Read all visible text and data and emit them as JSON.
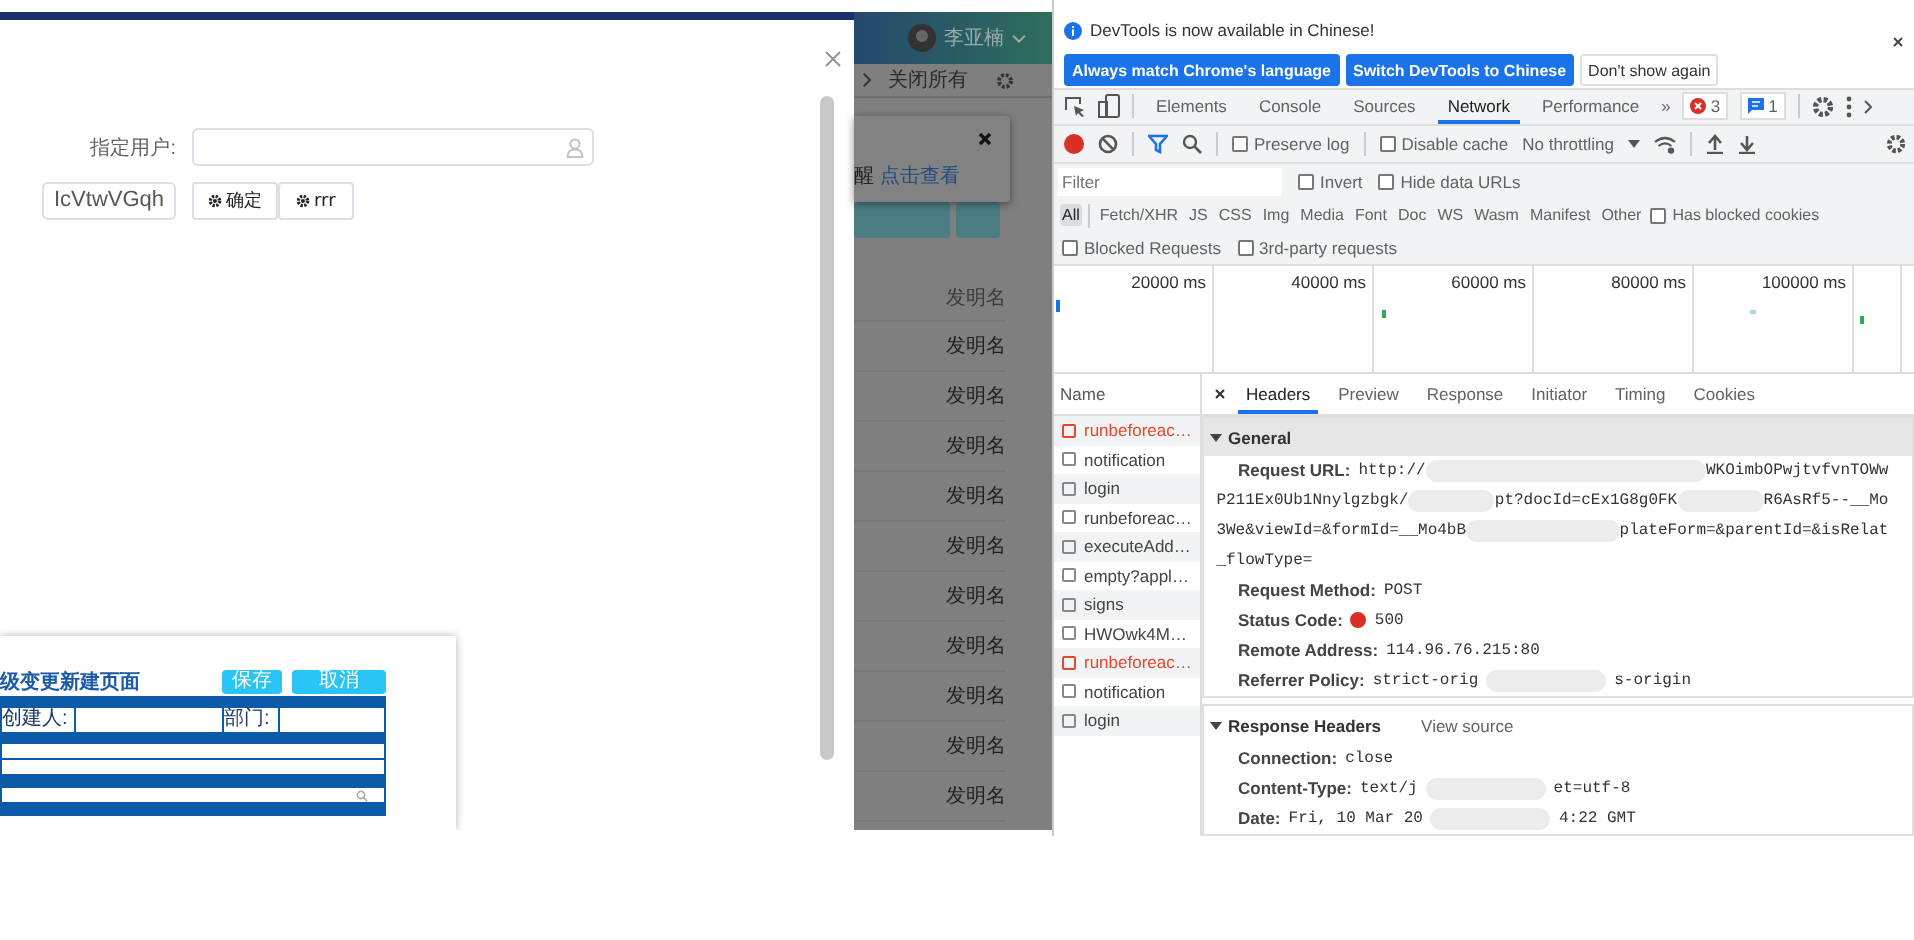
{
  "web_page": {
    "user_name": "李亚楠",
    "close_all": "关闭所有",
    "notification": {
      "text": "醒",
      "link": "点击查看"
    },
    "table": {
      "column_1": "发明名",
      "rows": [
        "发明名",
        "发明名",
        "发明名",
        "发明名",
        "发明名",
        "发明名",
        "发明名",
        "发明名",
        "发明名",
        "发明名"
      ]
    }
  },
  "dialog": {
    "field_label": "指定用户:",
    "code_field": {
      "value": "IcVtwVGqh"
    },
    "buttons": [
      "确定",
      "rrr"
    ],
    "preview": {
      "title": "级变更新建页面",
      "buttons": [
        "保存",
        "取消"
      ],
      "labels": [
        "创建人:",
        "部门:"
      ]
    }
  },
  "devtools": {
    "infobar": {
      "message": "DevTools is now available in Chinese!",
      "buttons": [
        {
          "label": "Always match Chrome's language",
          "primary": true
        },
        {
          "label": "Switch DevTools to Chinese",
          "primary": true
        },
        {
          "label": "Don't show again",
          "primary": false
        }
      ]
    },
    "tabs": [
      {
        "label": "Elements",
        "selected": false
      },
      {
        "label": "Console",
        "selected": false
      },
      {
        "label": "Sources",
        "selected": false
      },
      {
        "label": "Network",
        "selected": true
      },
      {
        "label": "Performance",
        "selected": false
      }
    ],
    "more_tabs": "»",
    "error_count": "3",
    "message_count": "1",
    "toolbar": [
      {
        "label": "Preserve log",
        "checked": false
      },
      {
        "label": "Disable cache",
        "checked": false
      }
    ],
    "throttling": "No throttling",
    "filter": {
      "placeholder": "Filter"
    },
    "filter_options": [
      {
        "label": "Invert",
        "checked": false
      },
      {
        "label": "Hide data URLs",
        "checked": false
      }
    ],
    "type_filters": [
      {
        "label": "All",
        "selected": true
      },
      {
        "label": "Fetch/XHR",
        "selected": false
      },
      {
        "label": "JS",
        "selected": false
      },
      {
        "label": "CSS",
        "selected": false
      },
      {
        "label": "Img",
        "selected": false
      },
      {
        "label": "Media",
        "selected": false
      },
      {
        "label": "Font",
        "selected": false
      },
      {
        "label": "Doc",
        "selected": false
      },
      {
        "label": "WS",
        "selected": false
      },
      {
        "label": "Wasm",
        "selected": false
      },
      {
        "label": "Manifest",
        "selected": false
      },
      {
        "label": "Other",
        "selected": false
      }
    ],
    "blocked_cookies": {
      "label": "Has blocked cookies",
      "checked": false
    },
    "more_filters": [
      {
        "label": "Blocked Requests",
        "checked": false
      },
      {
        "label": "3rd-party requests",
        "checked": false
      }
    ],
    "timeline": [
      "20000 ms",
      "40000 ms",
      "60000 ms",
      "80000 ms",
      "100000 ms"
    ],
    "requests": {
      "column": "Name",
      "items": [
        {
          "name": "runbeforeac…",
          "failed": true
        },
        {
          "name": "notification",
          "failed": false
        },
        {
          "name": "login",
          "failed": false
        },
        {
          "name": "runbeforeac…",
          "failed": false
        },
        {
          "name": "executeAdd…",
          "failed": false
        },
        {
          "name": "empty?appl…",
          "failed": false
        },
        {
          "name": "signs",
          "failed": false
        },
        {
          "name": "HWOwk4M…",
          "failed": false
        },
        {
          "name": "runbeforeac…",
          "failed": true
        },
        {
          "name": "notification",
          "failed": false
        },
        {
          "name": "login",
          "failed": false
        }
      ]
    },
    "detail_tabs": [
      {
        "label": "Headers",
        "selected": true
      },
      {
        "label": "Preview",
        "selected": false
      },
      {
        "label": "Response",
        "selected": false
      },
      {
        "label": "Initiator",
        "selected": false
      },
      {
        "label": "Timing",
        "selected": false
      },
      {
        "label": "Cookies",
        "selected": false
      }
    ],
    "sections": [
      {
        "title": "General",
        "expanded": true,
        "headers": [
          {
            "name": "Request URL:",
            "kind": "url",
            "lines": [
              [
                {
                  "kind": "text",
                  "text": "http://"
                },
                {
                  "kind": "redacted"
                },
                {
                  "kind": "text",
                  "text": "WKOimbOPwjtvfvnTOWw"
                }
              ],
              [
                {
                  "kind": "text",
                  "text": "P211Ex0Ub1Nnylgzbgk/"
                },
                {
                  "kind": "redacted"
                },
                {
                  "kind": "text",
                  "text": "pt?docId=cEx1G8g0FK"
                },
                {
                  "kind": "redacted"
                },
                {
                  "kind": "text",
                  "text": "R6AsRf5--__Mo"
                }
              ],
              [
                {
                  "kind": "text",
                  "text": "3We&viewId=&formId=__Mo4bB"
                },
                {
                  "kind": "redacted"
                },
                {
                  "kind": "text",
                  "text": "plateForm=&parentId=&isRelat"
                }
              ],
              [
                {
                  "kind": "text",
                  "text": "_flowType="
                }
              ]
            ]
          },
          {
            "name": "Request Method:",
            "kind": "plain",
            "segments": [
              {
                "kind": "text",
                "text": "POST"
              }
            ]
          },
          {
            "name": "Status Code:",
            "kind": "status",
            "segments": [
              {
                "kind": "text",
                "text": "500"
              }
            ]
          },
          {
            "name": "Remote Address:",
            "kind": "plain",
            "segments": [
              {
                "kind": "text",
                "text": "114.96.76.215:80"
              }
            ]
          },
          {
            "name": "Referrer Policy:",
            "kind": "plain",
            "segments": [
              {
                "kind": "text",
                "text": "strict-orig"
              },
              {
                "kind": "redacted"
              },
              {
                "kind": "text",
                "text": "s-origin"
              }
            ]
          }
        ]
      },
      {
        "title": "Response Headers",
        "expanded": true,
        "action": "View source",
        "headers": [
          {
            "name": "Connection:",
            "kind": "plain",
            "segments": [
              {
                "kind": "text",
                "text": "close"
              }
            ]
          },
          {
            "name": "Content-Type:",
            "kind": "plain",
            "segments": [
              {
                "kind": "text",
                "text": "text/j"
              },
              {
                "kind": "redacted"
              },
              {
                "kind": "text",
                "text": "et=utf-8"
              }
            ]
          },
          {
            "name": "Date:",
            "kind": "plain",
            "segments": [
              {
                "kind": "text",
                "text": "Fri, 10 Mar 20"
              },
              {
                "kind": "redacted"
              },
              {
                "kind": "text",
                "text": "4:22 GMT"
              }
            ]
          }
        ]
      }
    ]
  }
}
